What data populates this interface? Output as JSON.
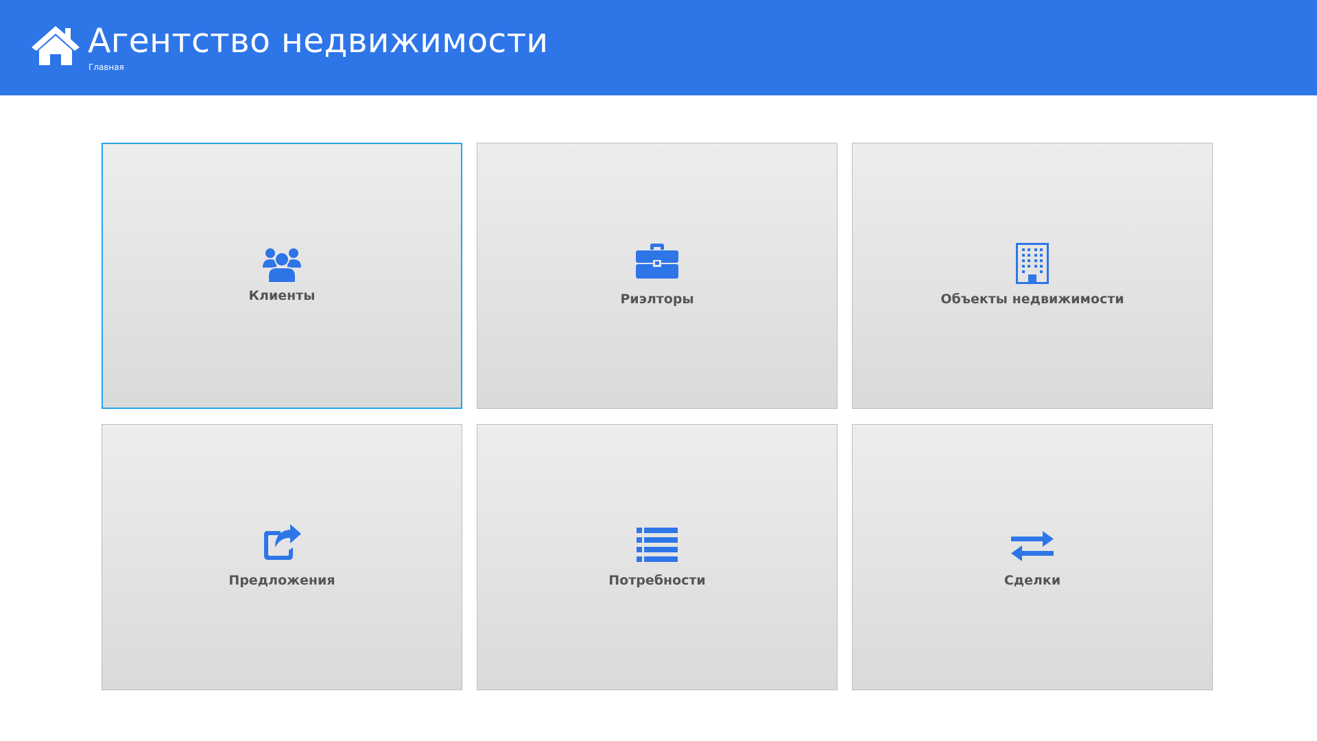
{
  "header": {
    "title": "Агентство недвижимости",
    "breadcrumb": "Главная",
    "home_icon": "home-icon",
    "background_color": "#2e75e8"
  },
  "tiles": [
    {
      "label": "Клиенты",
      "icon": "users-icon",
      "focused": true
    },
    {
      "label": "Риэлторы",
      "icon": "briefcase-icon",
      "focused": false
    },
    {
      "label": "Объекты недвижимости",
      "icon": "building-icon",
      "focused": false
    },
    {
      "label": "Предложения",
      "icon": "share-icon",
      "focused": false
    },
    {
      "label": "Потребности",
      "icon": "list-icon",
      "focused": false
    },
    {
      "label": "Сделки",
      "icon": "exchange-icon",
      "focused": false
    }
  ],
  "colors": {
    "accent": "#2e75e8",
    "icon": "#2e75e8",
    "tile_label": "#555555",
    "focus_border": "#27a4e6"
  }
}
